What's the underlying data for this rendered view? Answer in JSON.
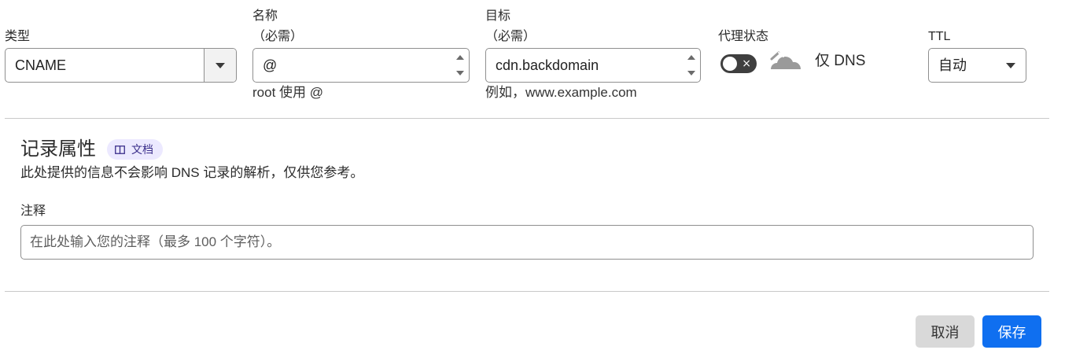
{
  "type_field": {
    "label": "类型",
    "value": "CNAME"
  },
  "name_field": {
    "label": "名称",
    "required": "（必需）",
    "value": "@",
    "help": "root 使用 @"
  },
  "target_field": {
    "label": "目标",
    "required": "（必需）",
    "value": "cdn.backdomain",
    "help": "例如，www.example.com"
  },
  "proxy": {
    "label": "代理状态",
    "toggle_on": false,
    "toggle_x": "×",
    "status_text": "仅 DNS",
    "icon": "cloud-icon",
    "cloud_color": "#9a9a9a"
  },
  "ttl_field": {
    "label": "TTL",
    "value": "自动"
  },
  "record_attributes": {
    "title": "记录属性",
    "doc_badge": "文档",
    "description": "此处提供的信息不会影响 DNS 记录的解析，仅供您参考。"
  },
  "comment": {
    "label": "注释",
    "placeholder": "在此处输入您的注释（最多 100 个字符）。"
  },
  "actions": {
    "cancel": "取消",
    "save": "保存"
  },
  "colors": {
    "primary": "#0f6ff0",
    "badge_bg": "#ece9ff",
    "toggle_off": "#3f3f3f"
  }
}
